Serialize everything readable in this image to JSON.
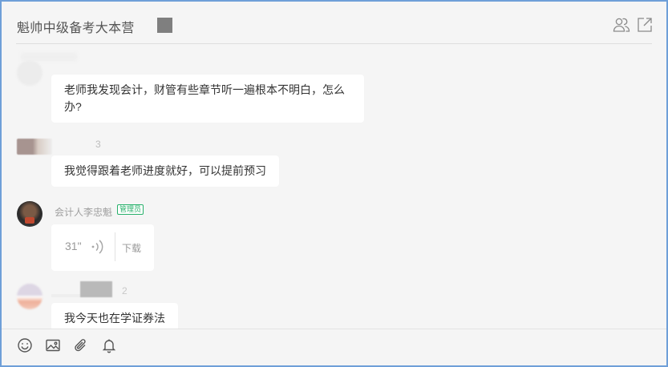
{
  "header": {
    "title": "魁帅中级备考大本营",
    "icons": [
      "members-icon",
      "popout-icon"
    ]
  },
  "messages": [
    {
      "type": "text",
      "nickname": "",
      "text": "老师我发现会计，财管有些章节听一遍根本不明白，怎么办?"
    },
    {
      "type": "text",
      "nickname": "3",
      "text": "我觉得跟着老师进度就好，可以提前预习"
    },
    {
      "type": "voice",
      "nickname": "会计人李忠魁",
      "badge": "管理员",
      "duration": "31\"",
      "download_label": "下载"
    },
    {
      "type": "text",
      "nickname": "2",
      "text": "我今天也在学证券法"
    }
  ],
  "toolbar": {
    "icons": [
      "emoji-icon",
      "image-icon",
      "attachment-icon",
      "bell-icon"
    ]
  },
  "colors": {
    "window_border": "#6f9fd8",
    "background": "#f5f5f5",
    "bubble": "#ffffff",
    "admin_badge": "#26b06a"
  }
}
